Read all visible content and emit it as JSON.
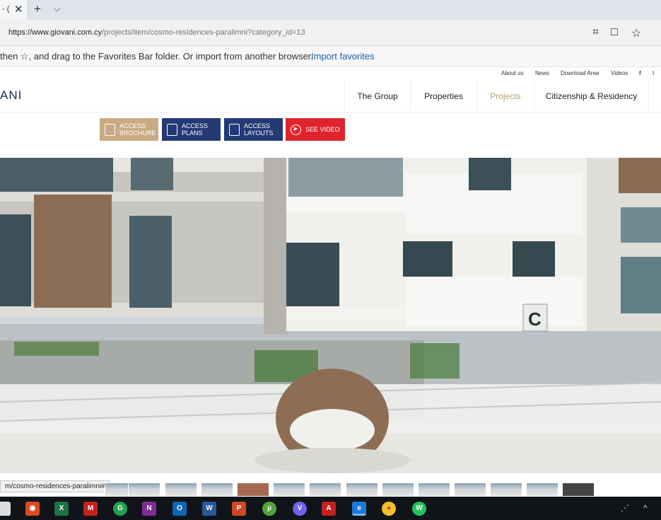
{
  "browser": {
    "tab_title": "- (",
    "tab_close": "✕",
    "new_tab": "+",
    "tab_list": "⌵",
    "url_domain": "https://www.giovani.com.cy",
    "url_path": "/projects/item/cosmo-residences-paralimni?category_id=13",
    "favorites_hint": "then ☆, and drag to the Favorites Bar folder. Or import from another browser.",
    "import_favorites": "Import favorites"
  },
  "site": {
    "logo": "ANI",
    "top_links": [
      "About us",
      "News",
      "Download Area",
      "Videos"
    ],
    "nav": [
      "The Group",
      "Properties",
      "Projects",
      "Citizenship & Residency"
    ],
    "active_nav": "Projects",
    "actions": [
      {
        "label": "ACCESS BROCHURE",
        "color": "#c9aa82"
      },
      {
        "label": "ACCESS PLANS",
        "color": "#233a75"
      },
      {
        "label": "ACCESS LAYOUTS",
        "color": "#233a75"
      },
      {
        "label": "SEE VIDEO",
        "color": "#e0242d"
      }
    ],
    "hero_sign": "C"
  },
  "status_url": "m/cosmo-residences-paralimni#",
  "taskbar": {
    "icons": [
      "app",
      "chrome-like",
      "excel-icon",
      "rat-icon",
      "green-icon",
      "onenote-icon",
      "outlook-icon",
      "word-icon",
      "powerpoint-icon",
      "utorrent-icon",
      "viber-icon",
      "acrobat-icon",
      "edge-icon",
      "chrome-icon",
      "whatsapp-icon"
    ],
    "tray": [
      "⋰",
      "^"
    ]
  }
}
